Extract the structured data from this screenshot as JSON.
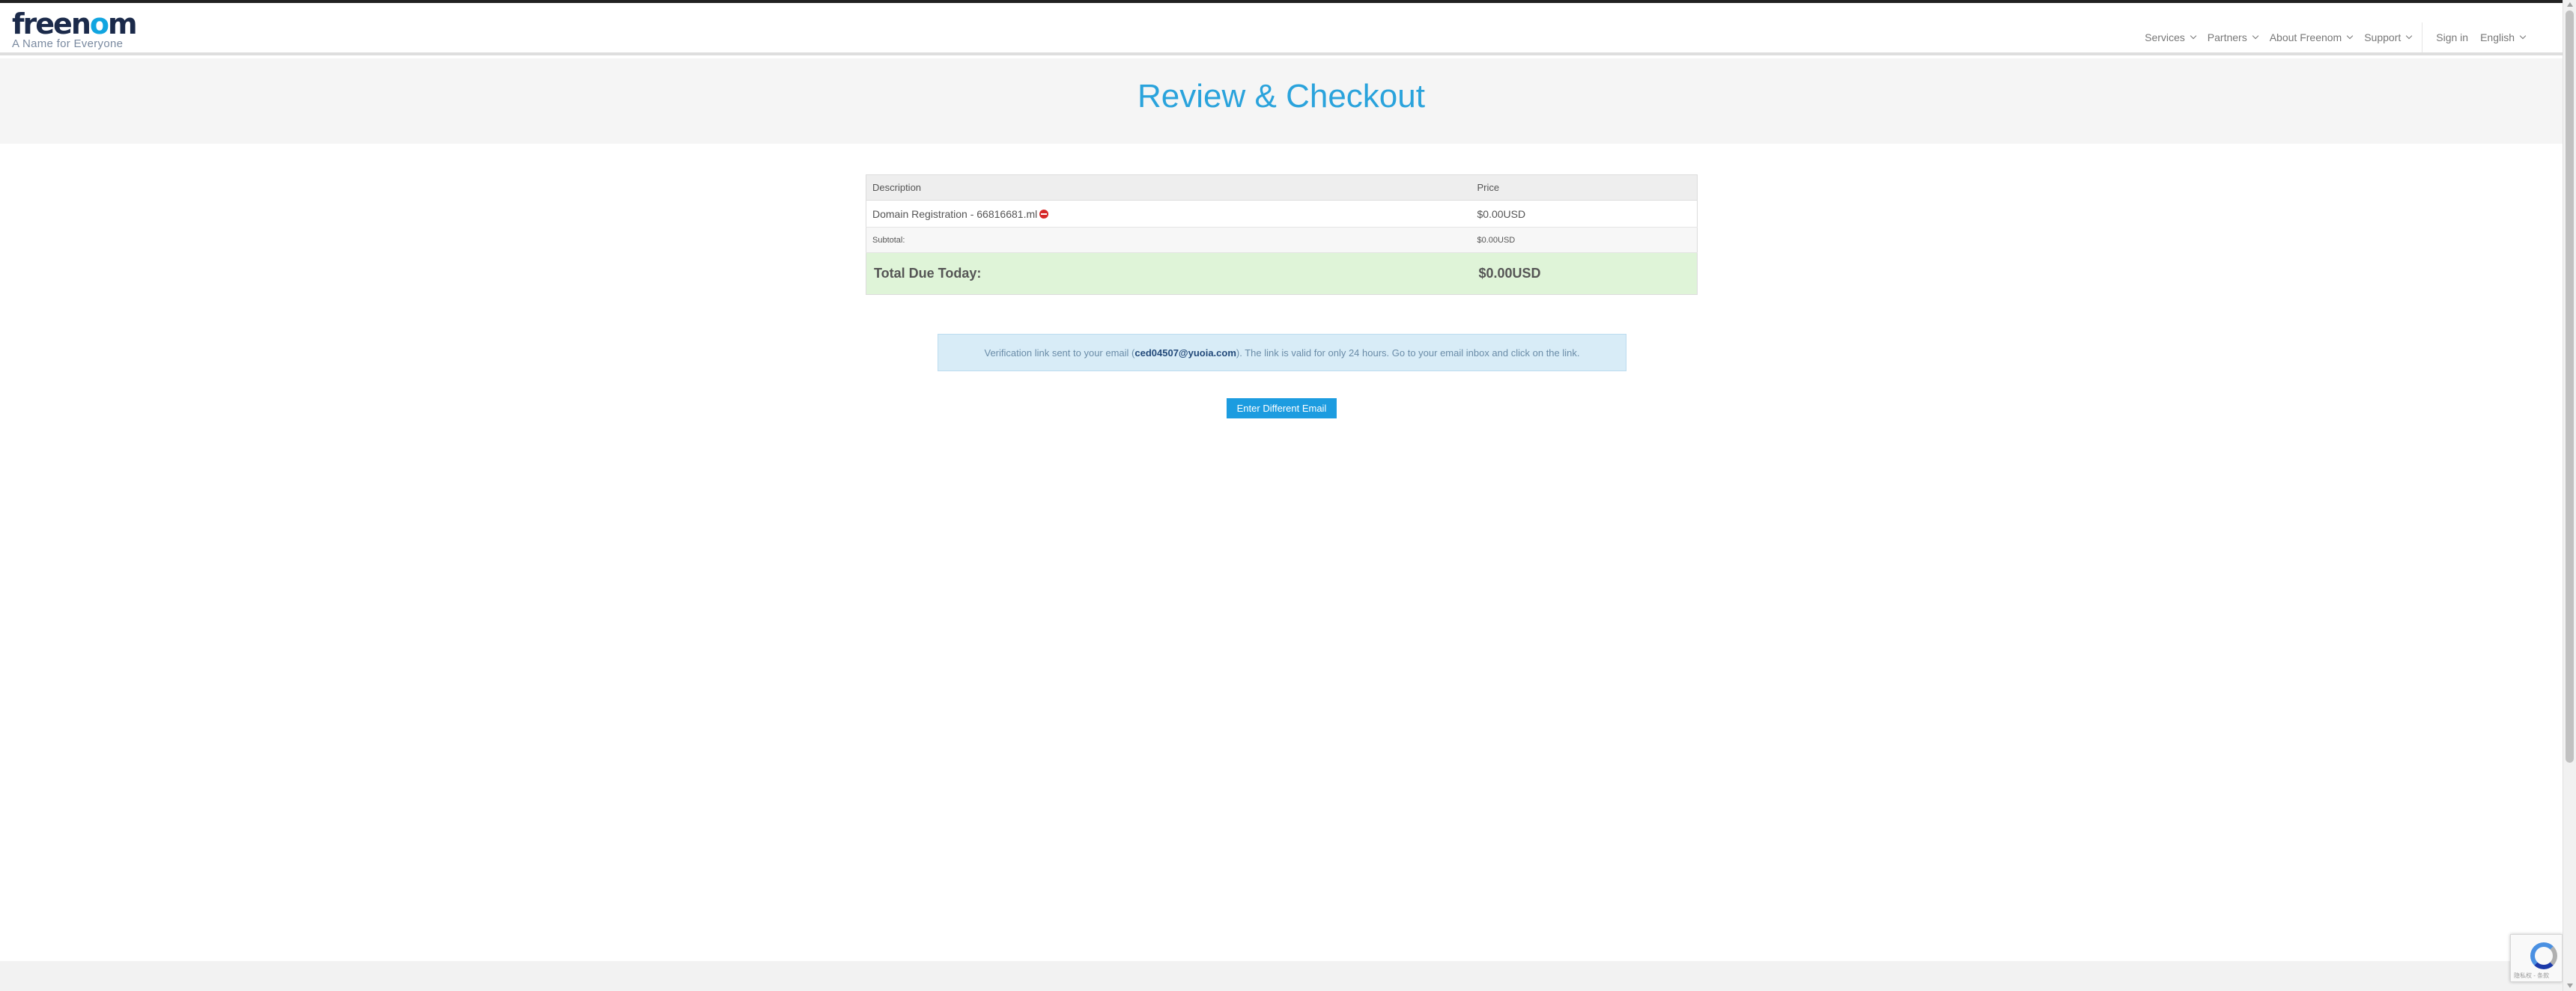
{
  "header": {
    "logo_main_prefix": "free",
    "logo_main_o": "o",
    "logo_main_n": "n",
    "logo_main_m": "m",
    "logo_tagline": "A Name for Everyone",
    "nav": {
      "services": "Services",
      "partners": "Partners",
      "about": "About Freenom",
      "support": "Support",
      "sign_in": "Sign in",
      "language": "English"
    }
  },
  "page": {
    "title": "Review & Checkout"
  },
  "cart": {
    "col_description": "Description",
    "col_price": "Price",
    "item_description": "Domain Registration - 66816681.ml",
    "item_price": "$0.00USD",
    "subtotal_label": "Subtotal:",
    "subtotal_value": "$0.00USD",
    "total_label": "Total Due Today:",
    "total_value": "$0.00USD"
  },
  "notice": {
    "prefix": "Verification link sent to your email (",
    "email": "ced04507@yuoia.com",
    "suffix": "). The link is valid for only 24 hours. Go to your email inbox and click on the link."
  },
  "actions": {
    "different_email": "Enter Different Email"
  },
  "recaptcha": {
    "text": "隐私权 - 条款"
  },
  "colors": {
    "accent": "#1c9ce0",
    "title": "#2aa3dc",
    "total_bg": "#dff4d8",
    "notice_bg": "#d8ecf7"
  }
}
